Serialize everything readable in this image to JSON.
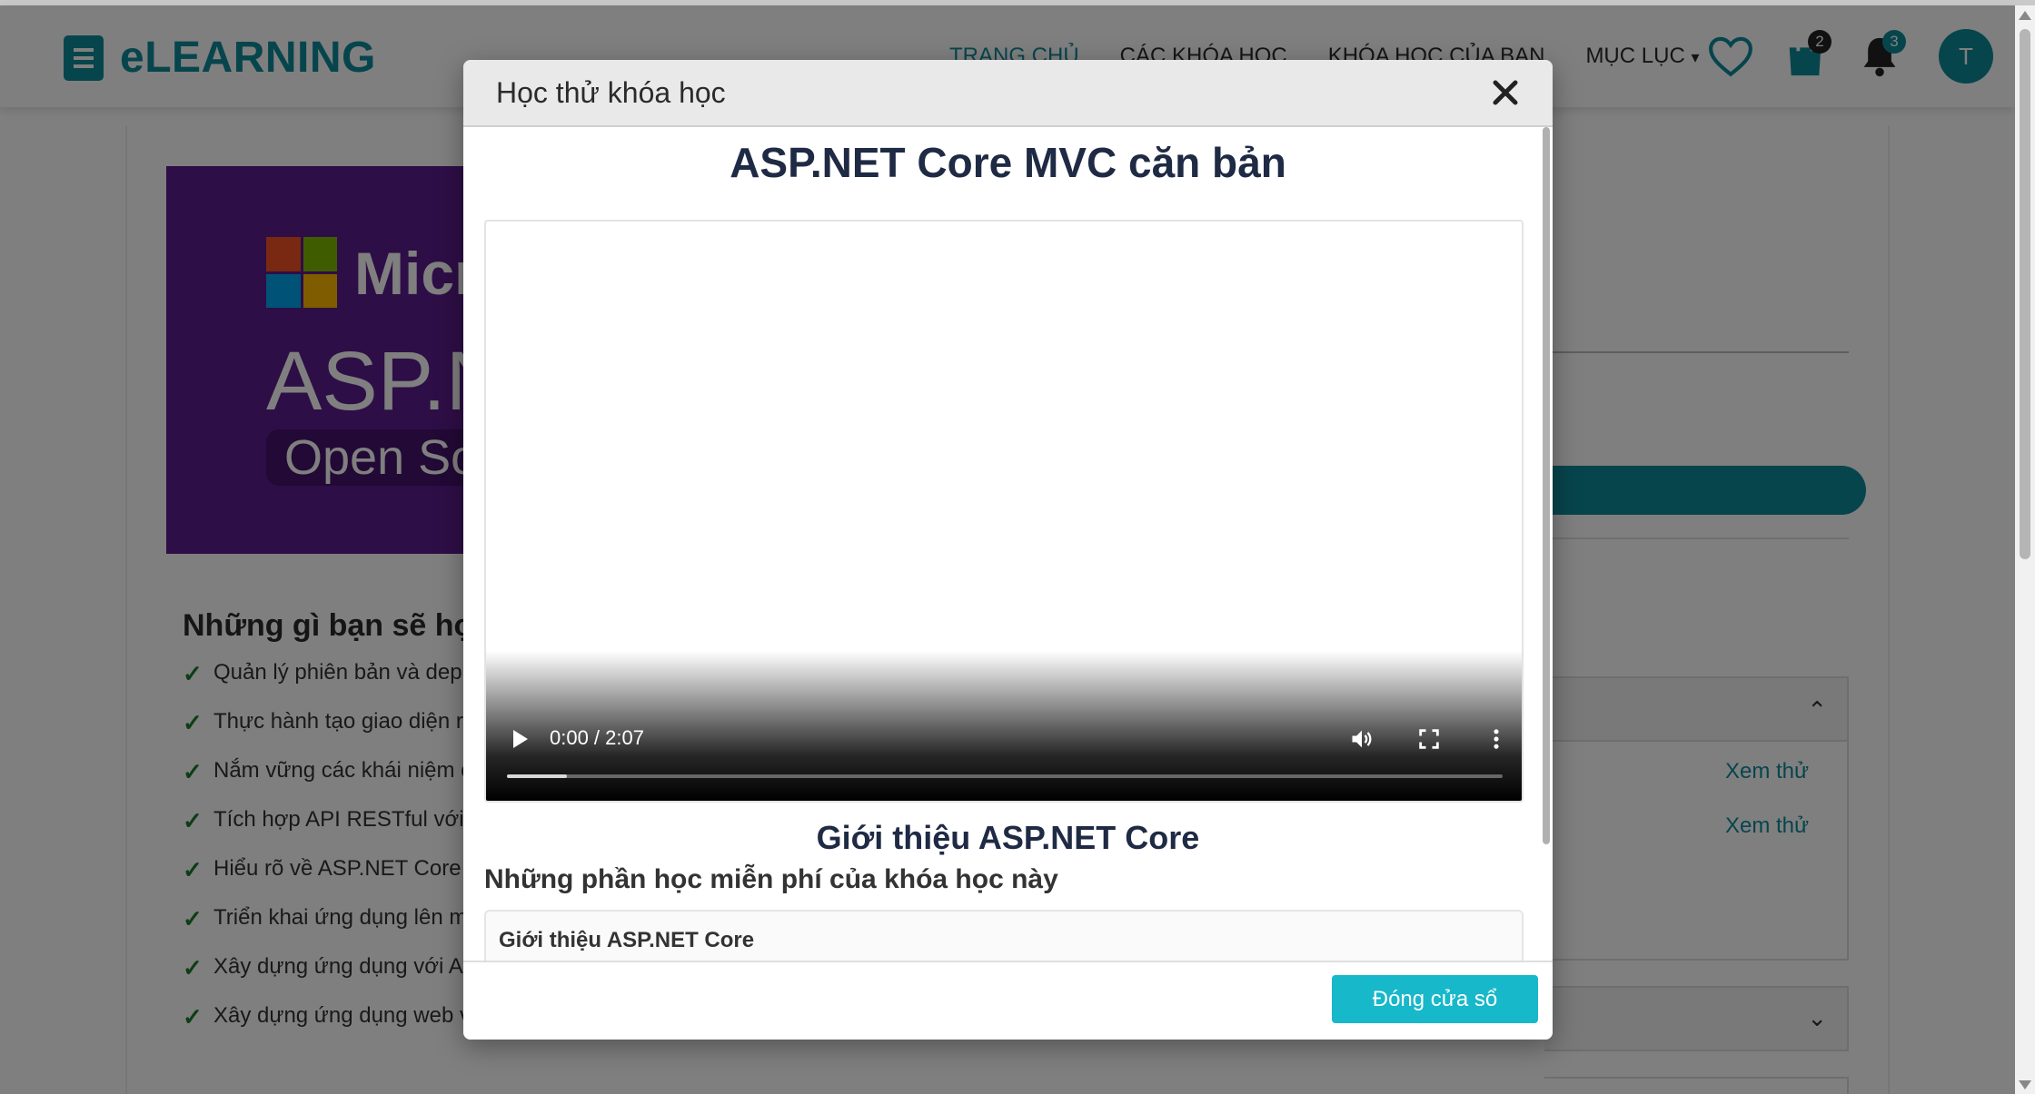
{
  "brand": {
    "name": "eLEARNING"
  },
  "nav": {
    "items": [
      {
        "label": "TRANG CHỦ",
        "active": true
      },
      {
        "label": "CÁC KHÓA HỌC"
      },
      {
        "label": "KHÓA HỌC CỦA BẠN"
      },
      {
        "label": "MỤC LỤC"
      }
    ],
    "cart_count": "2",
    "notification_count": "3",
    "avatar_initial": "T"
  },
  "course_page": {
    "banner": {
      "line1": "Micr",
      "line2": "ASP.N",
      "line3": "Open So"
    },
    "learn_title": "Những gì bạn sẽ họ",
    "learn_items": [
      "Quản lý phiên bản và dep",
      "Thực hành tạo giao diện r",
      "Nắm vững các khái niệm c",
      "Tích hợp API RESTful với",
      "Hiểu rõ về ASP.NET Core",
      "Triển khai ứng dụng lên m",
      "Xây dựng ứng dụng với A",
      "Xây dựng ứng dụng web v"
    ],
    "preview_links": [
      "Xem thử",
      "Xem thử"
    ]
  },
  "modal": {
    "title": "Học thử khóa học",
    "course_title": "ASP.NET Core MVC căn bản",
    "video": {
      "time": "0:00 / 2:07",
      "buffered": 0.06
    },
    "lesson_title": "Giới thiệu ASP.NET Core",
    "free_lessons_heading": "Những phần học miễn phí của khóa học này",
    "free_lessons": [
      "Giới thiệu ASP.NET Core"
    ],
    "close_button": "Đóng cửa sổ"
  },
  "colors": {
    "brand": "#0e8b9a",
    "button": "#17b8c9",
    "banner": "#5c1c8c"
  }
}
